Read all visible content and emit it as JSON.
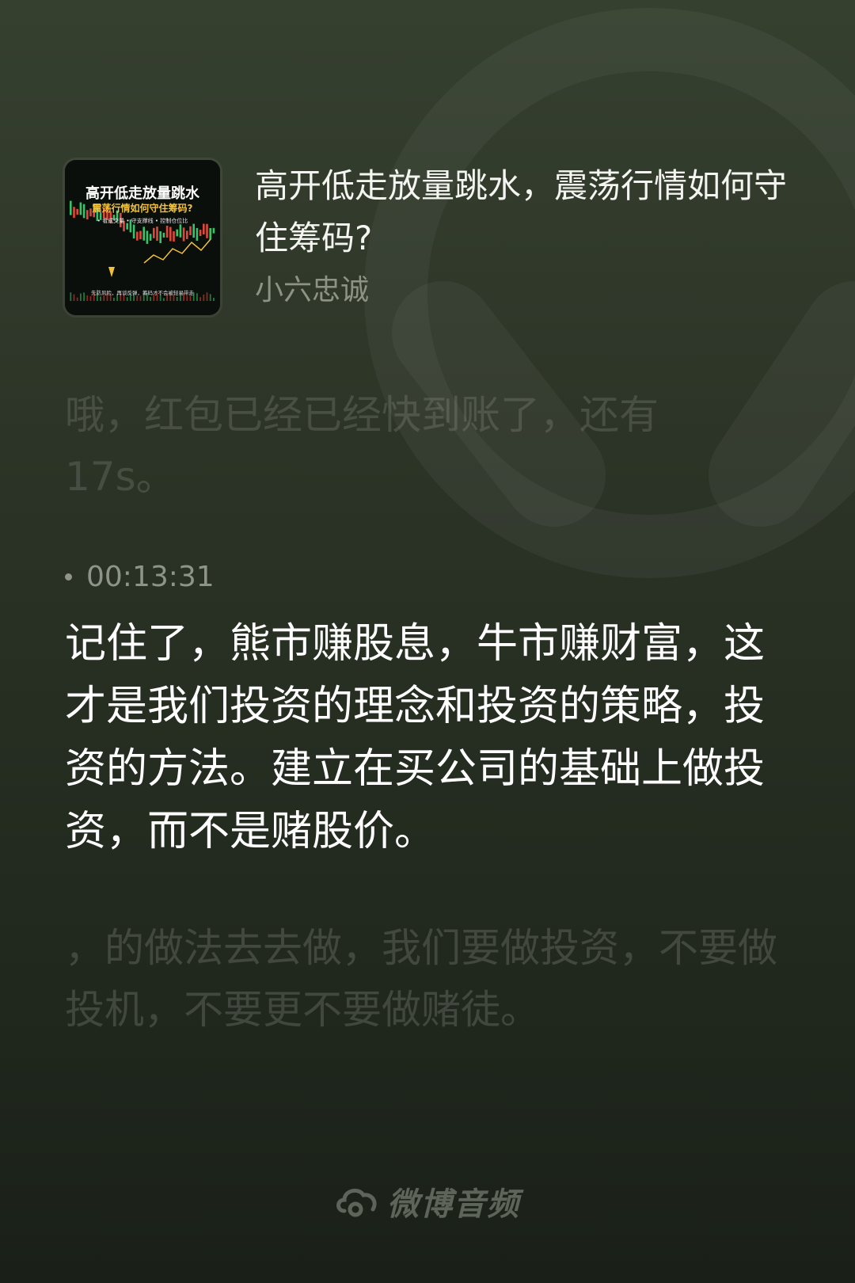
{
  "episode": {
    "title": "高开低走放量跳水，震荡行情如何守住筹码?",
    "author": "小六忠诚",
    "cover": {
      "headline": "高开低走放量跳水",
      "subheadline": "震荡行情如何守住筹码?",
      "tags": "• 看成交量  • 守支撑线  • 控制仓位比",
      "footer": "先防风险，再谈反弹，筹码才不会被轻易带走"
    }
  },
  "transcript": {
    "previous_line": "哦，红包已经已经快到账了，还有17s。",
    "current_timestamp": "00:13:31",
    "current_line": "记住了，熊市赚股息，牛市赚财富，这才是我们投资的理念和投资的策略，投资的方法。建立在买公司的基础上做投资，而不是赌股价。",
    "next_line": "，的做法去去做，我们要做投资，不要做投机，不要更不要做赌徒。"
  },
  "branding": {
    "watermark": "微博音频",
    "logo_icon": "weibo-audio-logo-icon"
  },
  "colors": {
    "background_top": "#36402f",
    "background_bottom": "#1a2018",
    "text_primary": "#ffffff",
    "text_muted": "#8d9487"
  }
}
